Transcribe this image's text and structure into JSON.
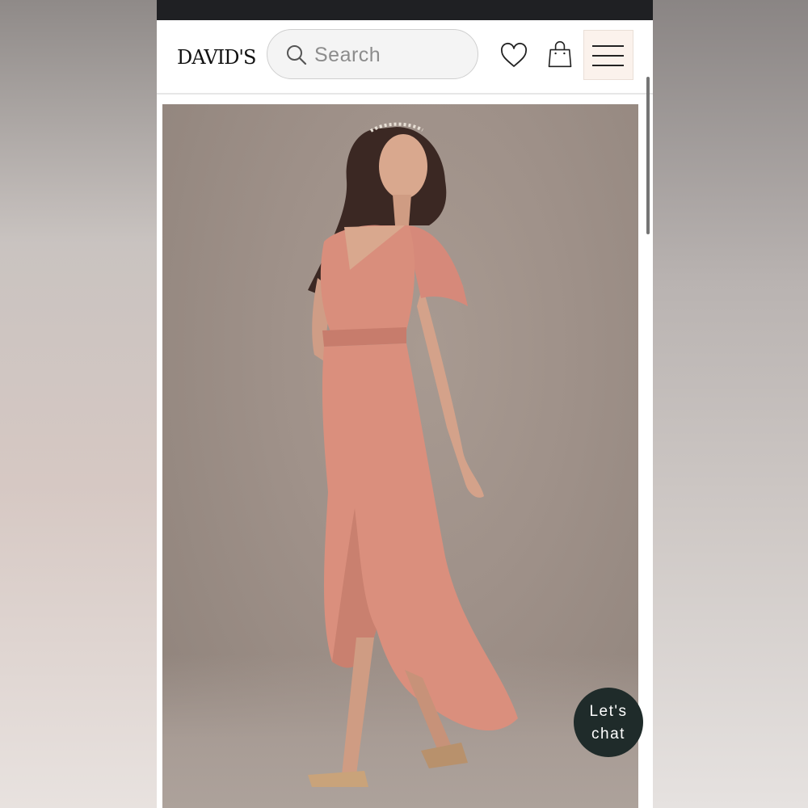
{
  "header": {
    "logo_text": "DAVID'S",
    "search": {
      "placeholder": "Search",
      "icon": "search-icon"
    },
    "wishlist_icon": "heart-icon",
    "bag_icon": "shopping-bag-icon",
    "menu_icon": "hamburger-menu-icon"
  },
  "product": {
    "image": "product-photo",
    "dress_color": "#d98e78"
  },
  "chat": {
    "line1": "Let's",
    "line2": "chat"
  },
  "colors": {
    "status_bar": "#1f2023",
    "chat_bg": "#1f2b2a",
    "menu_bg": "#fbf2ec"
  }
}
